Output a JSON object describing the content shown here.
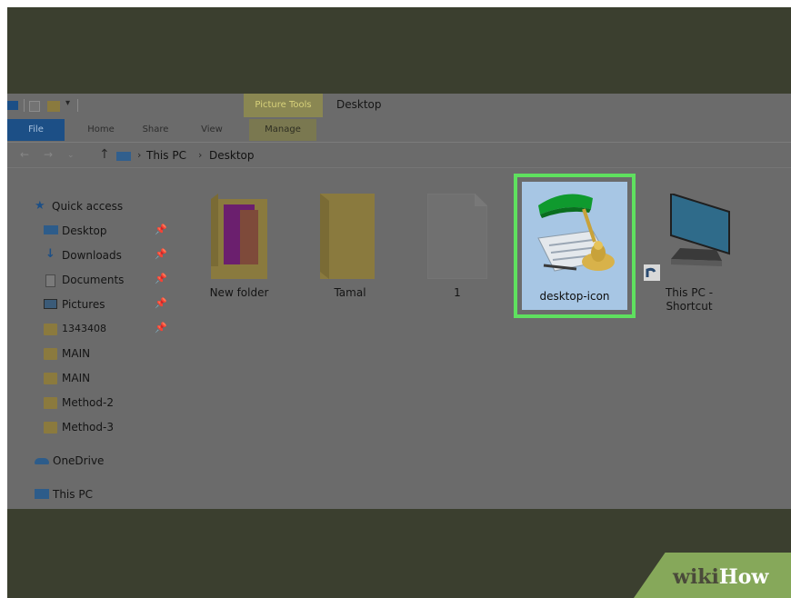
{
  "window": {
    "contextual_group": "Picture Tools",
    "title": "Desktop"
  },
  "ribbon": {
    "tabs": [
      "File",
      "Home",
      "Share",
      "View",
      "Manage"
    ]
  },
  "address_bar": {
    "crumbs": [
      "This PC",
      "Desktop"
    ]
  },
  "sidebar": {
    "quick_access": "Quick access",
    "pinned": [
      {
        "label": "Desktop",
        "icon": "desktop-icon"
      },
      {
        "label": "Downloads",
        "icon": "download-arrow-icon"
      },
      {
        "label": "Documents",
        "icon": "documents-icon"
      },
      {
        "label": "Pictures",
        "icon": "pictures-icon"
      },
      {
        "label": "1343408",
        "icon": "folder-icon"
      }
    ],
    "folders": [
      "MAIN",
      "MAIN",
      "Method-2",
      "Method-3"
    ],
    "onedrive": "OneDrive",
    "this_pc": "This PC"
  },
  "files": [
    {
      "label": "New folder",
      "icon": "folder-with-preview-icon"
    },
    {
      "label": "Tamal",
      "icon": "folder-icon"
    },
    {
      "label": "1",
      "icon": "blank-document-icon"
    },
    {
      "label": "desktop-icon",
      "icon": "banker-lamp-icon",
      "selected": true
    },
    {
      "label": "This PC -",
      "label2": "Shortcut",
      "icon": "monitor-shortcut-icon"
    }
  ],
  "branding": {
    "wiki": "wiki",
    "how": "How"
  },
  "colors": {
    "highlight": "#5fe05f",
    "file_tab": "#1c4f86",
    "contextual": "#8a8752"
  }
}
